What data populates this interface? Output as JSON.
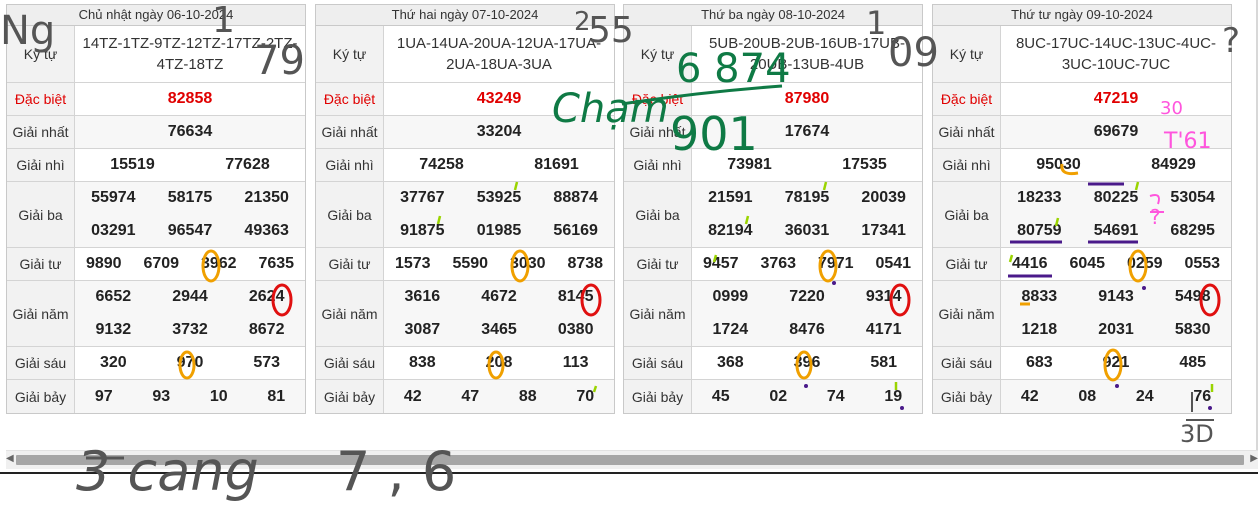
{
  "days": [
    {
      "date": "Chủ nhật ngày 06-10-2024",
      "code_label": "Ký tự",
      "code": "14TZ-1TZ-9TZ-12TZ-17TZ-2TZ-4TZ-18TZ",
      "special_label": "Đặc biệt",
      "special": "82858",
      "first_label": "Giải nhất",
      "first": "76634",
      "second_label": "Giải nhì",
      "second": [
        "15519",
        "77628"
      ],
      "third_label": "Giải ba",
      "third": [
        [
          "55974",
          "58175",
          "21350"
        ],
        [
          "03291",
          "96547",
          "49363"
        ]
      ],
      "fourth_label": "Giải tư",
      "fourth": [
        "9890",
        "6709",
        "3962",
        "7635"
      ],
      "fifth_label": "Giải năm",
      "fifth": [
        [
          "6652",
          "2944",
          "2624"
        ],
        [
          "9132",
          "3732",
          "8672"
        ]
      ],
      "sixth_label": "Giải sáu",
      "sixth": [
        "320",
        "970",
        "573"
      ],
      "seventh_label": "Giải bảy",
      "seventh": [
        "97",
        "93",
        "10",
        "81"
      ]
    },
    {
      "date": "Thứ hai ngày 07-10-2024",
      "code_label": "Ký tự",
      "code": "1UA-14UA-20UA-12UA-17UA-2UA-18UA-3UA",
      "special_label": "Đặc biệt",
      "special": "43249",
      "first_label": "Giải nhất",
      "first": "33204",
      "second_label": "Giải nhì",
      "second": [
        "74258",
        "81691"
      ],
      "third_label": "Giải ba",
      "third": [
        [
          "37767",
          "53925",
          "88874"
        ],
        [
          "91875",
          "01985",
          "56169"
        ]
      ],
      "fourth_label": "Giải tư",
      "fourth": [
        "1573",
        "5590",
        "3030",
        "8738"
      ],
      "fifth_label": "Giải năm",
      "fifth": [
        [
          "3616",
          "4672",
          "8145"
        ],
        [
          "3087",
          "3465",
          "0380"
        ]
      ],
      "sixth_label": "Giải sáu",
      "sixth": [
        "838",
        "208",
        "113"
      ],
      "seventh_label": "Giải bảy",
      "seventh": [
        "42",
        "47",
        "88",
        "70"
      ]
    },
    {
      "date": "Thứ ba ngày 08-10-2024",
      "code_label": "Ký tự",
      "code": "5UB-20UB-2UB-16UB-17UB-20UB-13UB-4UB",
      "special_label": "Đặc biệt",
      "special": "87980",
      "first_label": "Giải nhất",
      "first": "17674",
      "second_label": "Giải nhì",
      "second": [
        "73981",
        "17535"
      ],
      "third_label": "Giải ba",
      "third": [
        [
          "21591",
          "78195",
          "20039"
        ],
        [
          "82194",
          "36031",
          "17341"
        ]
      ],
      "fourth_label": "Giải tư",
      "fourth": [
        "9457",
        "3763",
        "7971",
        "0541"
      ],
      "fifth_label": "Giải năm",
      "fifth": [
        [
          "0999",
          "7220",
          "9314"
        ],
        [
          "1724",
          "8476",
          "4171"
        ]
      ],
      "sixth_label": "Giải sáu",
      "sixth": [
        "368",
        "396",
        "581"
      ],
      "seventh_label": "Giải bảy",
      "seventh": [
        "45",
        "02",
        "74",
        "19"
      ]
    },
    {
      "date": "Thứ tư ngày 09-10-2024",
      "code_label": "Ký tự",
      "code": "8UC-17UC-14UC-13UC-4UC-3UC-10UC-7UC",
      "special_label": "Đặc biệt",
      "special": "47219",
      "first_label": "Giải nhất",
      "first": "69679",
      "second_label": "Giải nhì",
      "second": [
        "95030",
        "84929"
      ],
      "third_label": "Giải ba",
      "third": [
        [
          "18233",
          "80225",
          "53054"
        ],
        [
          "80759",
          "54691",
          "68295"
        ]
      ],
      "fourth_label": "Giải tư",
      "fourth": [
        "4416",
        "6045",
        "0259",
        "0553"
      ],
      "fifth_label": "Giải năm",
      "fifth": [
        [
          "8833",
          "9143",
          "5498"
        ],
        [
          "1218",
          "2031",
          "5830"
        ]
      ],
      "sixth_label": "Giải sáu",
      "sixth": [
        "683",
        "921",
        "485"
      ],
      "seventh_label": "Giải bảy",
      "seventh": [
        "42",
        "08",
        "24",
        "76"
      ]
    }
  ],
  "annotations": {
    "ng": "Ng",
    "d1_top": "1",
    "d1_sub": "79",
    "d2_top": "2",
    "d2_sub": "55",
    "d4_top": "1",
    "d4_sub": "09",
    "d4_q": "?",
    "cham": "Chạm",
    "cham_nums": "6 874",
    "cham_sub": "901",
    "p30a": "30",
    "t61": "T'61",
    "q2": "?",
    "d30b": "3D",
    "bottom_word": "3 cang",
    "bottom_nums": "7 , 6",
    "colors": {
      "gray": "#666666",
      "green": "#0f7a45",
      "orange": "#f0a000",
      "red": "#e01010",
      "purple": "#4a1a8a",
      "pink": "#ff55dd",
      "lime": "#9ad400"
    }
  }
}
